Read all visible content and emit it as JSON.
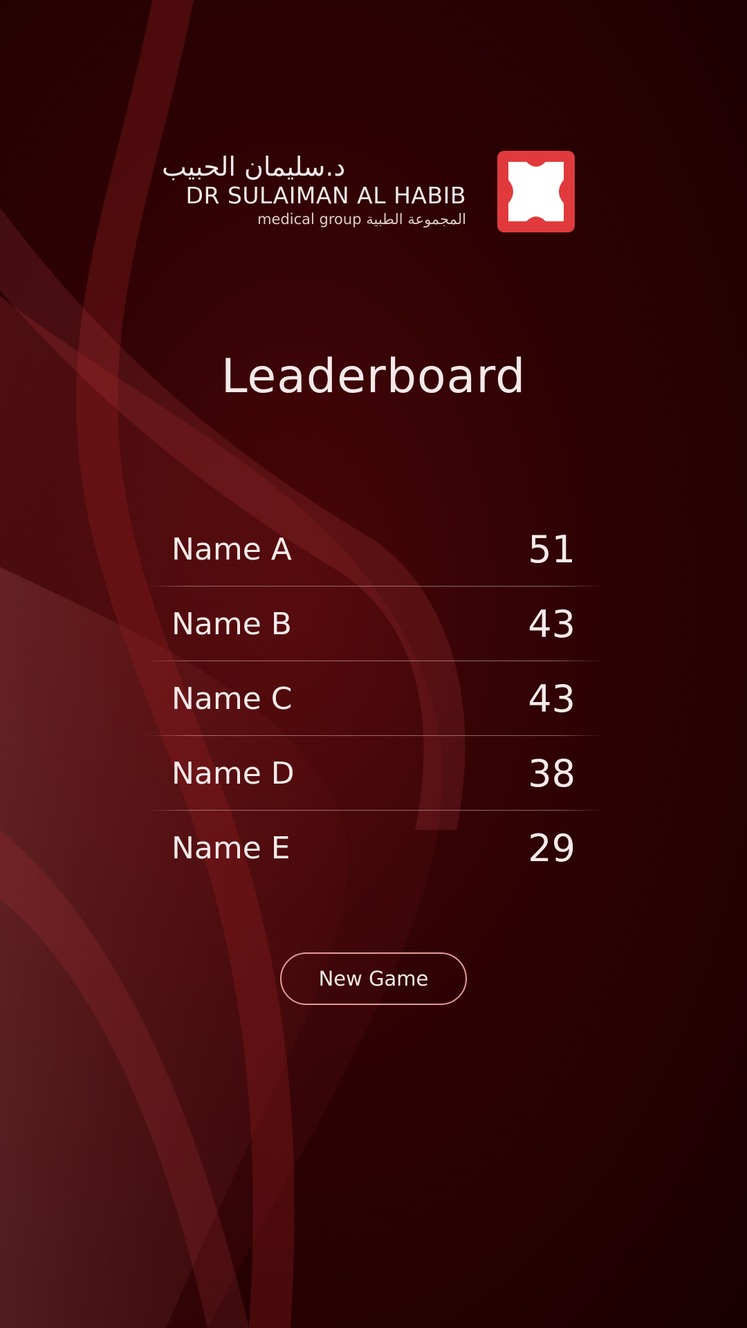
{
  "logo": {
    "arabic_name": "د.سليمان الحبيب",
    "english_name": "DR SULAIMAN AL HABIB",
    "subtitle": "medical group المجموعة الطبية",
    "icon": "cross-emblem-icon",
    "brand_color": "#e03a3c"
  },
  "title": "Leaderboard",
  "leaderboard": [
    {
      "name": "Name A",
      "score": "51"
    },
    {
      "name": "Name B",
      "score": "43"
    },
    {
      "name": "Name C",
      "score": "43"
    },
    {
      "name": "Name D",
      "score": "38"
    },
    {
      "name": "Name E",
      "score": "29"
    }
  ],
  "actions": {
    "new_game_label": "New Game"
  },
  "colors": {
    "background": "#2e0204",
    "text": "#f7eaea",
    "button_border": "#e59a98"
  }
}
